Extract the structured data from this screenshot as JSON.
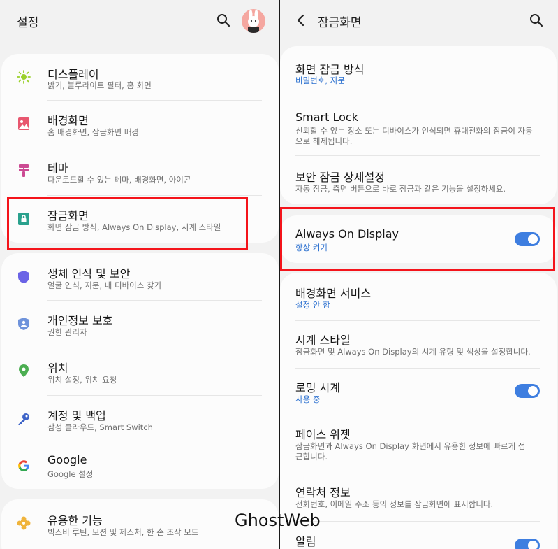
{
  "left": {
    "header": {
      "title": "설정"
    },
    "groups": [
      {
        "items": [
          {
            "title": "디스플레이",
            "sub": "밝기, 블루라이트 필터, 홈 화면",
            "icon": "sun-icon",
            "color": "#9ad12a"
          },
          {
            "title": "배경화면",
            "sub": "홈 배경화면, 잠금화면 배경",
            "icon": "image-icon",
            "color": "#e8576f"
          },
          {
            "title": "테마",
            "sub": "다운로드할 수 있는 테마, 배경화면, 아이콘",
            "icon": "paintbrush-icon",
            "color": "#cc4a93"
          },
          {
            "title": "잠금화면",
            "sub": "화면 잠금 방식, Always On Display, 시계 스타일",
            "icon": "lock-screen-icon",
            "color": "#2aa18d"
          }
        ]
      },
      {
        "items": [
          {
            "title": "생체 인식 및 보안",
            "sub": "얼굴 인식, 지문, 내 디바이스 찾기",
            "icon": "shield-icon",
            "color": "#6a63e6"
          },
          {
            "title": "개인정보 보호",
            "sub": "권한 관리자",
            "icon": "privacy-shield-icon",
            "color": "#6f93db"
          },
          {
            "title": "위치",
            "sub": "위치 설정, 위치 요청",
            "icon": "location-pin-icon",
            "color": "#4cae52"
          },
          {
            "title": "계정 및 백업",
            "sub": "삼성 클라우드, Smart Switch",
            "icon": "key-icon",
            "color": "#3e64c8"
          },
          {
            "title": "Google",
            "sub": "Google 설정",
            "icon": "google-icon",
            "color": "#4285f4"
          }
        ]
      },
      {
        "items": [
          {
            "title": "유용한 기능",
            "sub": "빅스비 루틴, 모션 및 제스처, 한 손 조작 모드",
            "icon": "puzzle-icon",
            "color": "#f0b43c"
          }
        ]
      }
    ]
  },
  "right": {
    "header": {
      "title": "잠금화면"
    },
    "groups": [
      {
        "items": [
          {
            "title": "화면 잠금 방식",
            "sub": "비밀번호, 지문",
            "sub_style": "blue"
          },
          {
            "title": "Smart Lock",
            "sub": "신뢰할 수 있는 장소 또는 디바이스가 인식되면 휴대전화의 잠금이 자동으로 해제됩니다.",
            "sub_style": "gray"
          },
          {
            "title": "보안 잠금 상세설정",
            "sub": "자동 잠금, 측면 버튼으로 바로 잠금과 같은 기능을 설정하세요.",
            "sub_style": "gray"
          }
        ]
      },
      {
        "items": [
          {
            "title": "Always On Display",
            "sub": "항상 켜기",
            "sub_style": "blue",
            "toggle": true
          }
        ]
      },
      {
        "items": [
          {
            "title": "배경화면 서비스",
            "sub": "설정 안 함",
            "sub_style": "blue"
          },
          {
            "title": "시계 스타일",
            "sub": "잠금화면 및 Always On Display의 시계 유형 및 색상을 설정합니다.",
            "sub_style": "gray"
          },
          {
            "title": "로밍 시계",
            "sub": "사용 중",
            "sub_style": "blue",
            "toggle": true
          },
          {
            "title": "페이스 위젯",
            "sub": "잠금화면과 Always On Display 화면에서 유용한 정보에 빠르게 접근합니다.",
            "sub_style": "gray"
          },
          {
            "title": "연락처 정보",
            "sub": "전화번호, 이메일 주소 등의 정보를 잠금화면에 표시합니다.",
            "sub_style": "gray"
          },
          {
            "title": "알림",
            "sub": "",
            "sub_style": "gray",
            "toggle": true
          }
        ]
      }
    ]
  },
  "colors": {
    "accent": "#3e7ee0",
    "highlight": "#f4141b",
    "blue_text": "#2a6fcf"
  },
  "watermark": "GhostWeb"
}
